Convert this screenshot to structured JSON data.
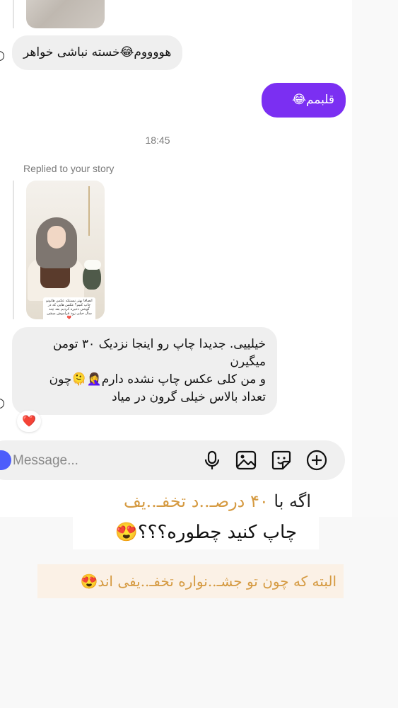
{
  "thread": {
    "msg_incoming_1": "هووووم😂خسته نباشی خواهر",
    "msg_outgoing_1": "قلبمم😂",
    "time": "18:45",
    "replied_label": "Replied to your story",
    "story_caption": "انصافا بهتر نیستکه عکس هاتونو چاپ کنیم؟ عکس هایی که در گوشی ذخیره کردیم بعد چند سال خیلی زود فراموش میشن💔",
    "msg_incoming_2": "خیلییی. جدیدا چاپ رو اینجا نزدیک ۳۰ تومن میگیرن\nو من کلی عکس چاپ نشده دارم🤦‍♀️🫠چون تعداد بالاس خیلی گرون در میاد",
    "reaction": "❤️"
  },
  "composer": {
    "placeholder": "Message...",
    "icons": [
      "microphone-icon",
      "gallery-icon",
      "sticker-icon",
      "add-icon"
    ]
  },
  "promo": {
    "line1_prefix": "اگه با",
    "line1_accent": "۴۰ درصـ..د تخفـ..یف",
    "line2": "چاپ کنید چطوره؟؟؟😍",
    "banner": "البته که  چون تو جشـ..نواره تخفـ..یفی اند😍"
  },
  "colors": {
    "outgoing_bubble": "#7b2ff2",
    "incoming_bubble": "#efefef",
    "accent_orange": "#d59a41"
  }
}
